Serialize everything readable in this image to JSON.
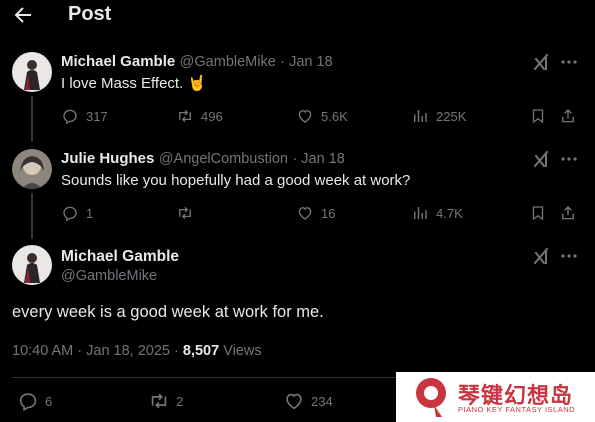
{
  "header": {
    "title": "Post"
  },
  "tweets": [
    {
      "name": "Michael Gamble",
      "handle": "@GambleMike",
      "date": "· Jan 18",
      "text": "I love Mass Effect.",
      "emoji": "🤘",
      "stats": {
        "replies": "317",
        "reposts": "496",
        "likes": "5.6K",
        "views": "225K"
      }
    },
    {
      "name": "Julie Hughes",
      "handle": "@AngelCombustion",
      "date": "· Jan 18",
      "text": "Sounds like you hopefully had a good week at work?",
      "stats": {
        "replies": "1",
        "reposts": "",
        "likes": "16",
        "views": "4.7K"
      }
    }
  ],
  "main_post": {
    "name": "Michael Gamble",
    "handle": "@GambleMike",
    "text": "every week is a good week at work for me.",
    "timestamp": "10:40 AM · Jan 18, 2025 · ",
    "view_count": "8,507",
    "views_label": " Views",
    "stats": {
      "replies": "6",
      "reposts": "2",
      "likes": "234"
    }
  },
  "watermark": {
    "title": "琴键幻想岛",
    "subtitle": "PIANO KEY FANTASY ISLAND"
  },
  "icons": {
    "back": "arrow-left-icon",
    "reply": "speech-bubble-icon",
    "repost": "repost-arrows-icon",
    "like": "heart-icon",
    "views": "bar-chart-icon",
    "bookmark": "bookmark-icon",
    "share": "share-icon",
    "grok": "grok-icon",
    "more": "more-icon"
  },
  "colors": {
    "background": "#000000",
    "text": "#e7e9ea",
    "muted": "#71767b",
    "watermark": "#c8343f"
  }
}
